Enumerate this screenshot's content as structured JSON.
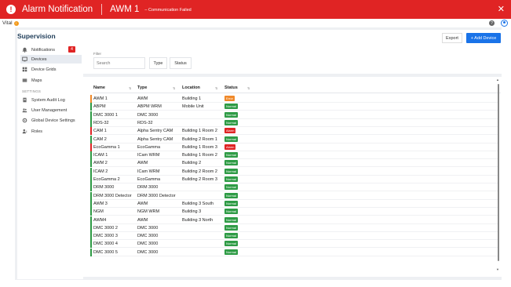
{
  "alarm": {
    "title": "Alarm Notification",
    "device": "AWM 1",
    "message": "– Communication Failed",
    "icon": "alert-icon",
    "close_label": "✕",
    "color": "#e02424"
  },
  "app": {
    "name": "Vital",
    "help_label": "?"
  },
  "sidebar": {
    "title": "Supervision",
    "items": [
      {
        "label": "Notifications",
        "icon": "bell-icon",
        "badge": "4"
      },
      {
        "label": "Devices",
        "icon": "monitor-icon"
      },
      {
        "label": "Device Grids",
        "icon": "grid-icon"
      },
      {
        "label": "Maps",
        "icon": "map-icon"
      }
    ],
    "section_label": "SETTINGS",
    "settings_items": [
      {
        "label": "System Audit Log",
        "icon": "document-icon"
      },
      {
        "label": "User Management",
        "icon": "users-icon"
      },
      {
        "label": "Global Device Settings",
        "icon": "gear-icon"
      },
      {
        "label": "Roles",
        "icon": "person-icon"
      }
    ]
  },
  "toolbar": {
    "export_label": "Export",
    "add_label": "+ Add Device",
    "accent": "#1a73e8"
  },
  "filter": {
    "label": "Filter",
    "search_placeholder": "Search",
    "type_label": "Type",
    "status_label": "Status"
  },
  "table": {
    "columns": [
      "Name",
      "Type",
      "Location",
      "Status"
    ],
    "status_colors": {
      "Error": "#f0892a",
      "Normal": "#2e9b45",
      "Alarm": "#e02424"
    },
    "rows": [
      {
        "name": "AWM 1",
        "type": "AWM",
        "location": "Building 1",
        "status": "Error"
      },
      {
        "name": "ABPM",
        "type": "ABPM WRM",
        "location": "Mobile Unit",
        "status": "Normal"
      },
      {
        "name": "DMC 3000 1",
        "type": "DMC 3000",
        "location": "",
        "status": "Normal"
      },
      {
        "name": "RDS-32",
        "type": "RDS-32",
        "location": "",
        "status": "Normal"
      },
      {
        "name": "CAM 1",
        "type": "Alpha Sentry CAM",
        "location": "Building 1 Room 2",
        "status": "Alarm"
      },
      {
        "name": "CAM 2",
        "type": "Alpha Sentry CAM",
        "location": "Building 2 Room 1",
        "status": "Normal"
      },
      {
        "name": "EcoGamma 1",
        "type": "EcoGamma",
        "location": "Building 1 Room 3",
        "status": "Alarm"
      },
      {
        "name": "ICAM 1",
        "type": "ICam WRM",
        "location": "Building 1 Room 2",
        "status": "Normal"
      },
      {
        "name": "AWM 2",
        "type": "AWM",
        "location": "Building 2",
        "status": "Normal"
      },
      {
        "name": "ICAM 2",
        "type": "ICam WRM",
        "location": "Building 2 Room 2",
        "status": "Normal"
      },
      {
        "name": "EcoGamma 2",
        "type": "EcoGamma",
        "location": "Building 2 Room 3",
        "status": "Normal"
      },
      {
        "name": "DRM 3000",
        "type": "DRM 3000",
        "location": "",
        "status": "Normal"
      },
      {
        "name": "DRM 3000 Detector",
        "type": "DRM 3000 Detector",
        "location": "",
        "status": "Normal"
      },
      {
        "name": "AWM 3",
        "type": "AWM",
        "location": "Building 3 South",
        "status": "Normal"
      },
      {
        "name": "NGM",
        "type": "NGM WRM",
        "location": "Building 3",
        "status": "Normal"
      },
      {
        "name": "AWM4",
        "type": "AWM",
        "location": "Building 3 North",
        "status": "Normal"
      },
      {
        "name": "DMC 3000 2",
        "type": "DMC 3000",
        "location": "",
        "status": "Normal"
      },
      {
        "name": "DMC 3000 3",
        "type": "DMC 3000",
        "location": "",
        "status": "Normal"
      },
      {
        "name": "DMC 3000 4",
        "type": "DMC 3000",
        "location": "",
        "status": "Normal"
      },
      {
        "name": "DMC 3000 5",
        "type": "DMC 3000",
        "location": "",
        "status": "Normal"
      }
    ]
  }
}
